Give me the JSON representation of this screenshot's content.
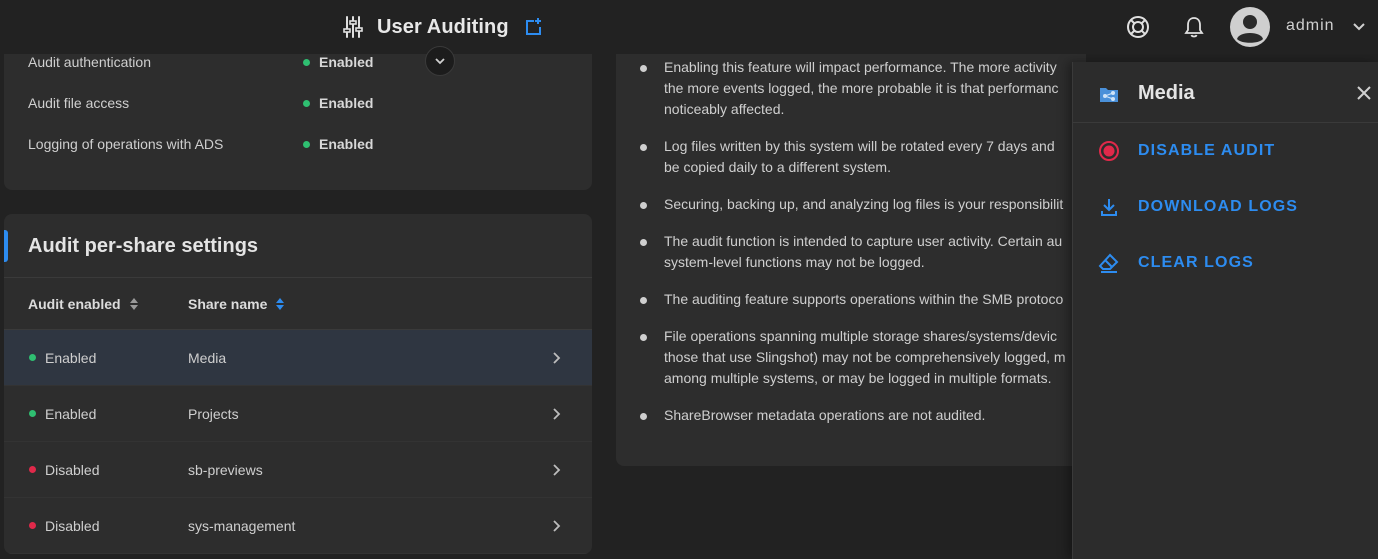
{
  "topbar": {
    "title": "User Auditing",
    "user": "admin",
    "icons": [
      "tune-icon",
      "open-in-new-icon",
      "chevron-down-icon",
      "help-lifebuoy-icon",
      "bell-icon",
      "account-circle-icon",
      "chevron-down-icon"
    ]
  },
  "audit_settings": {
    "rows": [
      {
        "label": "Audit authentication",
        "status": "Enabled"
      },
      {
        "label": "Audit file access",
        "status": "Enabled"
      },
      {
        "label": "Logging of operations with ADS",
        "status": "Enabled"
      }
    ]
  },
  "share_settings": {
    "title": "Audit per-share settings",
    "columns": [
      "Audit enabled",
      "Share name"
    ],
    "rows": [
      {
        "status": "Enabled",
        "name": "Media",
        "selected": true
      },
      {
        "status": "Enabled",
        "name": "Projects",
        "selected": false
      },
      {
        "status": "Disabled",
        "name": "sb-previews",
        "selected": false
      },
      {
        "status": "Disabled",
        "name": "sys-management",
        "selected": false
      }
    ]
  },
  "notes": {
    "items": [
      {
        "lines": [
          "Enabling this feature will impact performance. The more activity",
          "the more events logged, the more probable it is that performanc",
          "noticeably affected."
        ]
      },
      {
        "lines": [
          "Log files written by this system will be rotated every 7 days and",
          "be copied daily to a different system."
        ]
      },
      {
        "lines": [
          "Securing, backing up, and analyzing log files is your responsibilit"
        ]
      },
      {
        "lines": [
          "The audit function is intended to capture user activity. Certain au",
          "system-level functions may not be logged."
        ]
      },
      {
        "lines": [
          "The auditing feature supports operations within the SMB protoco"
        ]
      },
      {
        "lines": [
          "File operations spanning multiple storage shares/systems/devic",
          "those that use Slingshot) may not be comprehensively logged, m",
          "among multiple systems, or may be logged in multiple formats."
        ]
      },
      {
        "lines": [
          "ShareBrowser metadata operations are not audited."
        ]
      }
    ]
  },
  "side_panel": {
    "title": "Media",
    "actions": [
      {
        "label": "DISABLE AUDIT",
        "icon": "record-icon"
      },
      {
        "label": "DOWNLOAD LOGS",
        "icon": "download-icon"
      },
      {
        "label": "CLEAR LOGS",
        "icon": "eraser-icon"
      }
    ]
  },
  "colors": {
    "accent": "#2d8cf0",
    "enabled": "#2fbf71",
    "disabled": "#e0294a",
    "background": "#222222",
    "card": "#2d2d2d"
  }
}
